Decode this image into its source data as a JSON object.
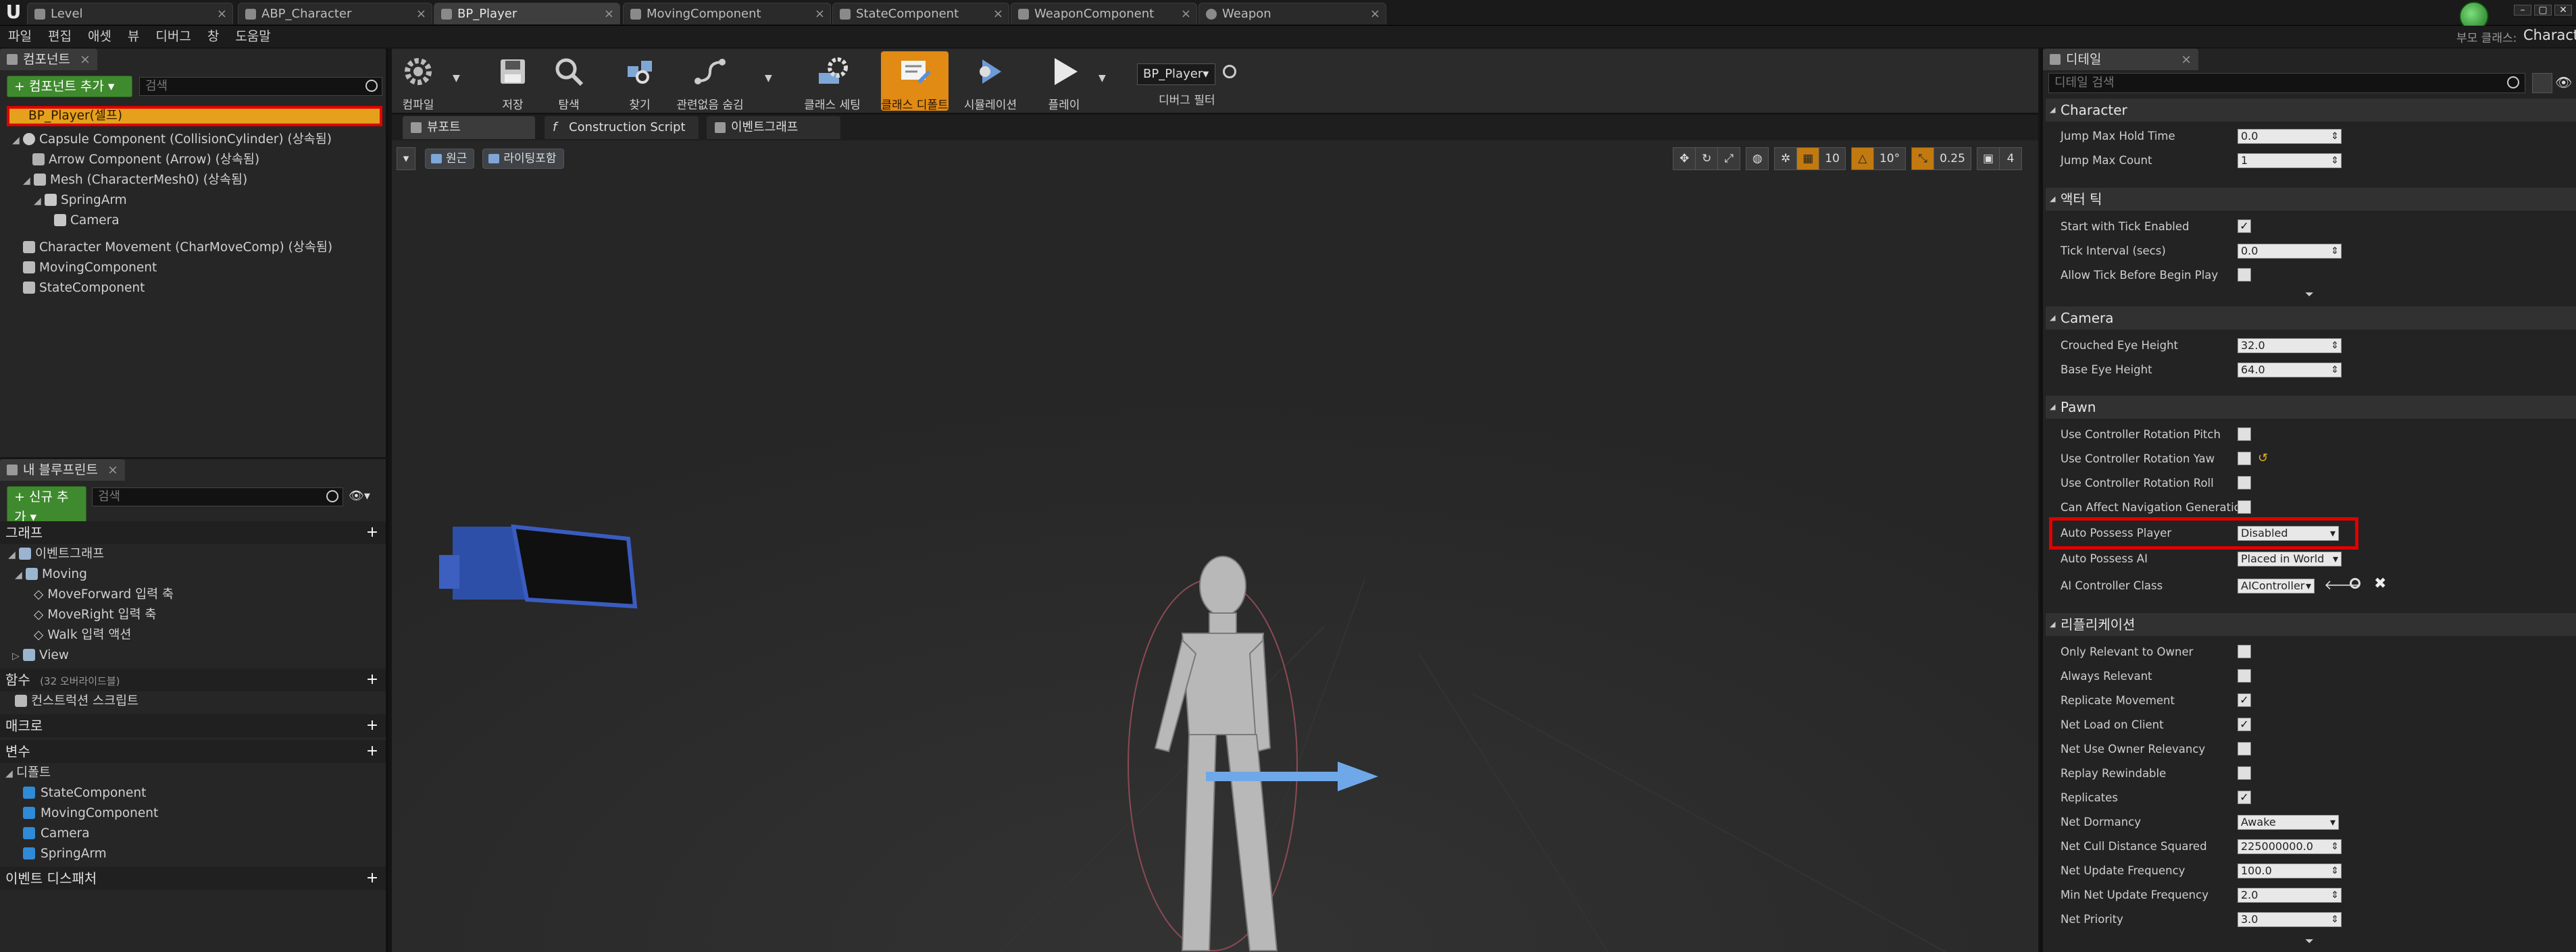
{
  "window": {
    "logo": "U",
    "tabs": [
      {
        "label": "Level"
      },
      {
        "label": "ABP_Character"
      },
      {
        "label": "BP_Player"
      },
      {
        "label": "MovingComponent"
      },
      {
        "label": "StateComponent"
      },
      {
        "label": "WeaponComponent"
      },
      {
        "label": "Weapon"
      }
    ],
    "project_label": "부모 클래스:",
    "project_name": "Characte",
    "controls": [
      "–",
      "▢",
      "✕"
    ]
  },
  "menu": [
    "파일",
    "편집",
    "애셋",
    "뷰",
    "디버그",
    "창",
    "도움말"
  ],
  "components": {
    "tab_label": "컴포넌트",
    "add_button": "+ 컴포넌트 추가 ▾",
    "search_placeholder": "검색",
    "root": "BP_Player(셀프)",
    "items": [
      "Capsule Component (CollisionCylinder) (상속됨)",
      "Arrow Component (Arrow) (상속됨)",
      "Mesh (CharacterMesh0) (상속됨)",
      "SpringArm",
      "Camera",
      "Character Movement (CharMoveComp) (상속됨)",
      "MovingComponent",
      "StateComponent"
    ]
  },
  "my_blueprint": {
    "tab_label": "내 블루프린트",
    "add_button": "+ 신규 추가 ▾",
    "search_placeholder": "검색",
    "graphs_header": "그래프",
    "event_graph": "이벤트그래프",
    "moving_group": "Moving",
    "events": [
      "MoveForward 입력 축",
      "MoveRight 입력 축",
      "Walk 입력 액션"
    ],
    "view_group": "View",
    "functions_header": "함수",
    "functions_count": "(32 오버라이드블)",
    "construction_script": "컨스트럭션 스크립트",
    "macros_header": "매크로",
    "variables_header": "변수",
    "default_group": "디폴트",
    "variables": [
      "StateComponent",
      "MovingComponent",
      "Camera",
      "SpringArm"
    ],
    "dispatchers_header": "이벤트 디스패처"
  },
  "toolbar": {
    "buttons": [
      {
        "label": "컴파일",
        "icon": "compile-icon"
      },
      {
        "label": "저장",
        "icon": "save-icon"
      },
      {
        "label": "탐색",
        "icon": "browse-icon"
      },
      {
        "label": "찾기",
        "icon": "find-icon"
      },
      {
        "label": "관련없음 숨김",
        "icon": "hide-unrelated-icon"
      },
      {
        "label": "클래스 세팅",
        "icon": "class-settings-icon"
      },
      {
        "label": "클래스 디폴트",
        "icon": "class-defaults-icon"
      },
      {
        "label": "시뮬레이션",
        "icon": "simulation-icon"
      },
      {
        "label": "플레이",
        "icon": "play-icon"
      }
    ],
    "debug_object": "BP_Player▾",
    "debug_filter_label": "디버그 필터"
  },
  "editor_tabs": [
    "뷰포트",
    "Construction Script",
    "이벤트그래프"
  ],
  "viewport": {
    "view_mode_pill": "원근",
    "lighting_pill": "라이팅포함",
    "grid_snap": "10",
    "rot_snap": "10°",
    "scale_snap": "0.25",
    "camera_speed": "4"
  },
  "details": {
    "tab_label": "디테일",
    "search_placeholder": "디테일 검색",
    "sections": [
      {
        "title": "Character",
        "props": [
          {
            "label": "Jump Max Hold Time",
            "type": "num",
            "value": "0.0"
          },
          {
            "label": "Jump Max Count",
            "type": "num",
            "value": "1"
          }
        ]
      },
      {
        "title": "액터 틱",
        "props": [
          {
            "label": "Start with Tick Enabled",
            "type": "check",
            "value": true
          },
          {
            "label": "Tick Interval (secs)",
            "type": "num",
            "value": "0.0"
          },
          {
            "label": "Allow Tick Before Begin Play",
            "type": "check",
            "value": false
          }
        ]
      },
      {
        "title": "Camera",
        "props": [
          {
            "label": "Crouched Eye Height",
            "type": "num",
            "value": "32.0"
          },
          {
            "label": "Base Eye Height",
            "type": "num",
            "value": "64.0"
          }
        ]
      },
      {
        "title": "Pawn",
        "props": [
          {
            "label": "Use Controller Rotation Pitch",
            "type": "check",
            "value": false
          },
          {
            "label": "Use Controller Rotation Yaw",
            "type": "check",
            "value": false
          },
          {
            "label": "Use Controller Rotation Roll",
            "type": "check",
            "value": false
          },
          {
            "label": "Can Affect Navigation Generation",
            "type": "check",
            "value": false
          },
          {
            "label": "Auto Possess Player",
            "type": "dd",
            "value": "Disabled"
          },
          {
            "label": "Auto Possess AI",
            "type": "dd",
            "value": "Placed in World"
          },
          {
            "label": "AI Controller Class",
            "type": "dd",
            "value": "AIController"
          }
        ]
      },
      {
        "title": "리플리케이션",
        "props": [
          {
            "label": "Only Relevant to Owner",
            "type": "check",
            "value": false
          },
          {
            "label": "Always Relevant",
            "type": "check",
            "value": false
          },
          {
            "label": "Replicate Movement",
            "type": "check",
            "value": true
          },
          {
            "label": "Net Load on Client",
            "type": "check",
            "value": true
          },
          {
            "label": "Net Use Owner Relevancy",
            "type": "check",
            "value": false
          },
          {
            "label": "Replay Rewindable",
            "type": "check",
            "value": false
          },
          {
            "label": "Replicates",
            "type": "check",
            "value": true
          },
          {
            "label": "Net Dormancy",
            "type": "dd",
            "value": "Awake"
          },
          {
            "label": "Net Cull Distance Squared",
            "type": "num",
            "value": "225000000.0"
          },
          {
            "label": "Net Update Frequency",
            "type": "num",
            "value": "100.0"
          },
          {
            "label": "Min Net Update Frequency",
            "type": "num",
            "value": "2.0"
          },
          {
            "label": "Net Priority",
            "type": "num",
            "value": "3.0"
          }
        ]
      }
    ]
  },
  "colors": {
    "accent_orange": "#e6a01c",
    "highlight_red": "#e00000",
    "add_green": "#3f8a2e"
  }
}
